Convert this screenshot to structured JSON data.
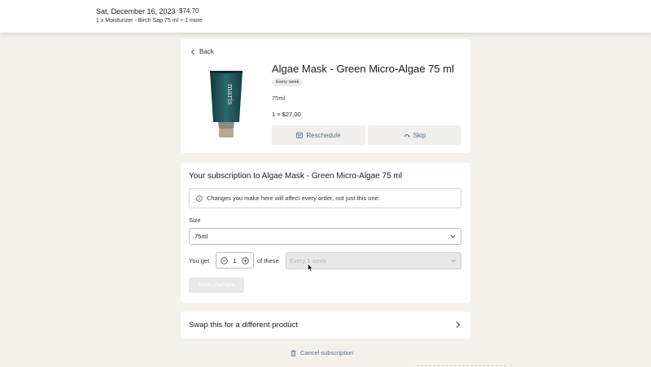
{
  "order": {
    "date": "Sat, December 16, 2023",
    "total": "$74.70",
    "items_summary": "1 x Moisturizer - Birch Sap 75 ml + 1 more"
  },
  "product": {
    "back_label": "Back",
    "brand_text": "maris",
    "title": "Algae Mask - Green Micro-Algae 75 ml",
    "frequency_badge": "Every week",
    "volume": "75ml",
    "quantity_price": "1 × $27.00",
    "reschedule_label": "Reschedule",
    "skip_label": "Skip"
  },
  "subscription": {
    "heading": "Your subscription to Algae Mask - Green Micro-Algae 75 ml",
    "notice": "Changes you make here will affect every order, not just this one.",
    "size_label": "Size",
    "size_value": "75ml",
    "you_get_label": "You get",
    "quantity": "1",
    "of_these_label": "of these",
    "frequency_value": "Every 1 week",
    "save_label": "Save changes"
  },
  "swap": {
    "label": "Swap this for a different product"
  },
  "cancel": {
    "label": "Cancel subscription"
  },
  "colors": {
    "background": "#f4f1ec",
    "card": "#ffffff",
    "action_text": "#5a6b8a",
    "product_tube": "#1f4f52"
  },
  "icons": {
    "back": "chevron-left-icon",
    "reschedule": "calendar-icon",
    "skip": "skip-arc-icon",
    "notice": "info-circle-icon",
    "select": "chevron-down-icon",
    "decrement": "minus-circle-icon",
    "increment": "plus-circle-icon",
    "swap": "chevron-right-icon",
    "cancel": "trash-icon"
  }
}
